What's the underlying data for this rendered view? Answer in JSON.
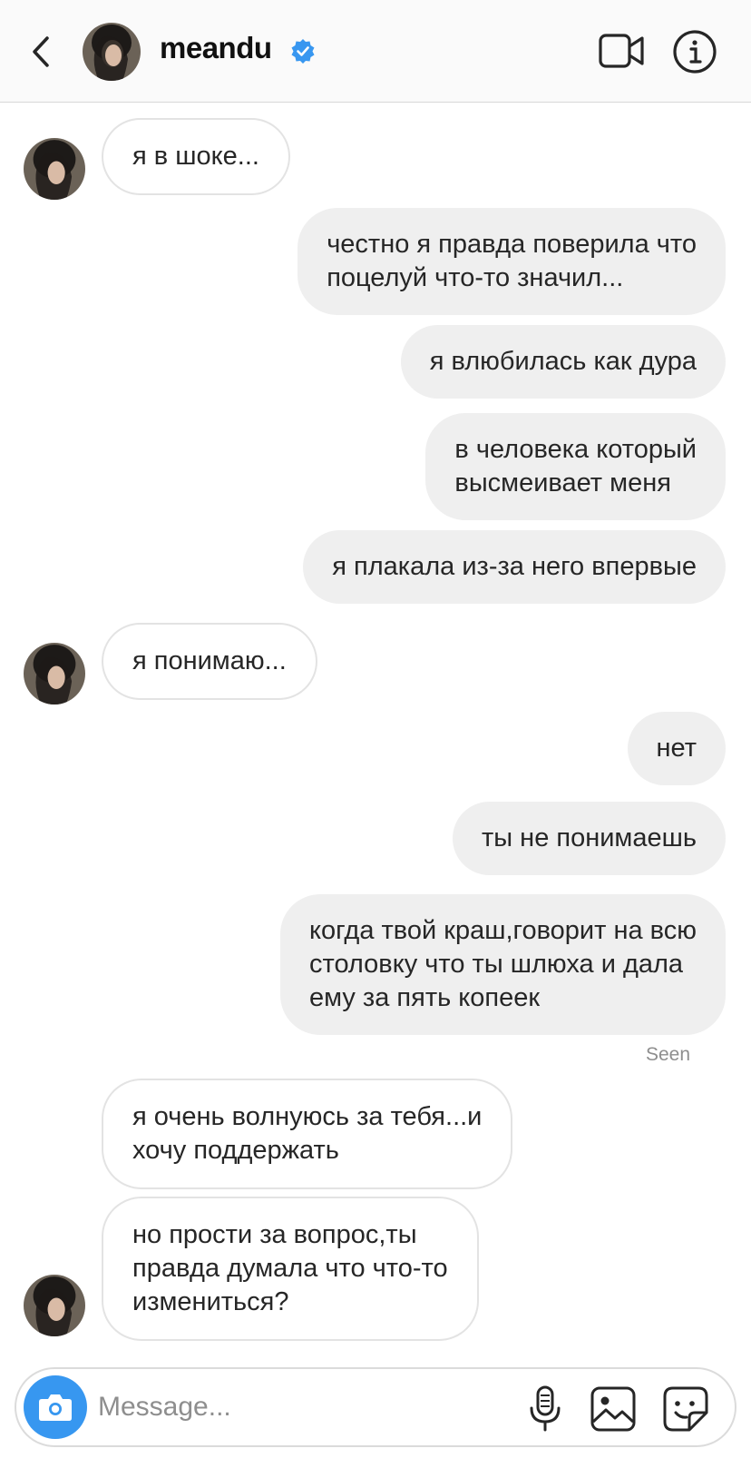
{
  "header": {
    "username": "meandu",
    "verified": true,
    "icons": [
      "chevron-left-icon",
      "video-camera-icon",
      "info-icon"
    ]
  },
  "messages": [
    {
      "side": "in",
      "text": "я в шоке..."
    },
    {
      "side": "out",
      "text": "честно я правда поверила что\nпоцелуй что-то значил..."
    },
    {
      "side": "out",
      "text": "я влюбилась как дура"
    },
    {
      "side": "out",
      "text": "в человека который\nвысмеивает меня"
    },
    {
      "side": "out",
      "text": "я плакала из-за него впервые"
    },
    {
      "side": "in",
      "text": "я понимаю..."
    },
    {
      "side": "out",
      "text": "нет"
    },
    {
      "side": "out",
      "text": "ты не понимаешь"
    },
    {
      "side": "out",
      "text": "когда твой краш,говорит на всю\nстоловку что ты шлюха и дала\nему за пять копеек"
    },
    {
      "side": "in",
      "text": "я очень волнуюсь за тебя...и\nхочу поддержать"
    },
    {
      "side": "in",
      "text": "но прости за вопрос,ты\nправда думала что что-то\nизмениться?"
    }
  ],
  "seen_label": "Seen",
  "composer": {
    "placeholder": "Message...",
    "icons": [
      "camera-icon",
      "microphone-icon",
      "gallery-icon",
      "sticker-icon"
    ]
  },
  "colors": {
    "accent": "#3797f0",
    "outgoing_bubble": "#efefef",
    "incoming_border": "#e3e3e3",
    "verified": "#3897f0"
  }
}
